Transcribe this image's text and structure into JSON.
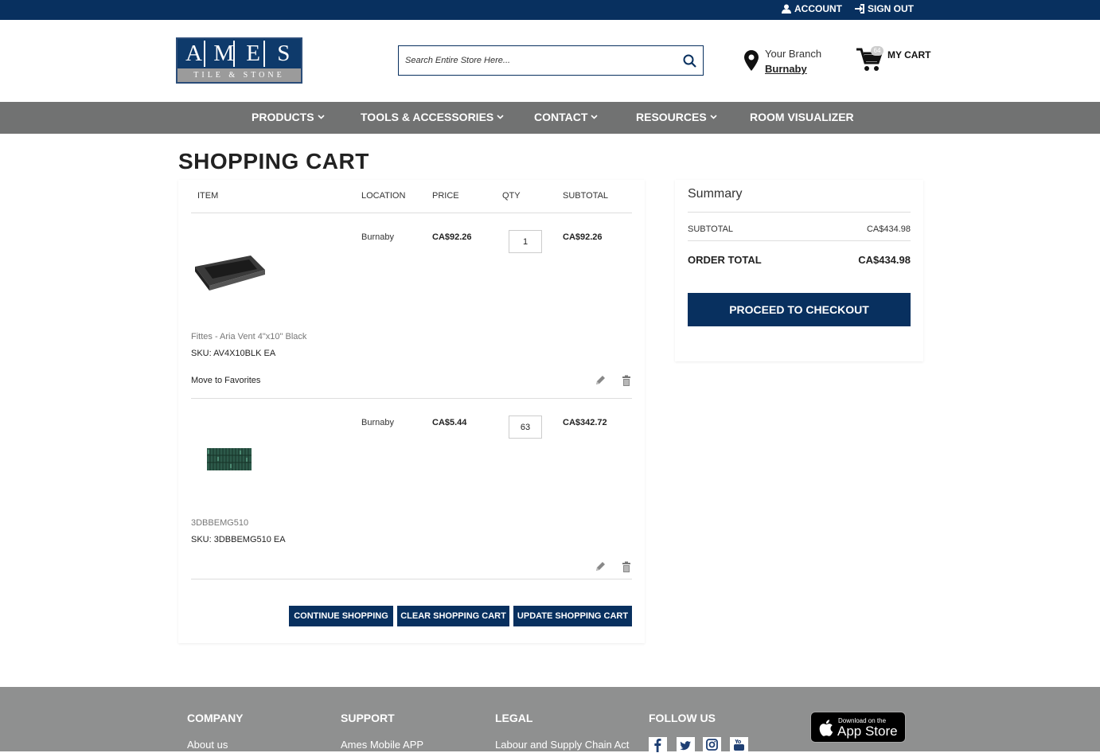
{
  "topbar": {
    "account": "ACCOUNT",
    "signout": "SIGN OUT"
  },
  "logo": {
    "letters": [
      "A",
      "M",
      "E",
      "S"
    ],
    "sub": "TILE & STONE"
  },
  "search": {
    "placeholder": "Search Entire Store Here..."
  },
  "branch": {
    "label": "Your Branch",
    "name": "Burnaby"
  },
  "cart": {
    "label": "MY CART",
    "count": "64"
  },
  "nav": {
    "products": "PRODUCTS",
    "tools": "TOOLS & ACCESSORIES",
    "contact": "CONTACT",
    "resources": "RESOURCES",
    "room": "ROOM VISUALIZER"
  },
  "page_title": "SHOPPING CART",
  "table": {
    "item": "ITEM",
    "location": "LOCATION",
    "price": "PRICE",
    "qty": "QTY",
    "subtotal": "SUBTOTAL"
  },
  "items": [
    {
      "location": "Burnaby",
      "price": "CA$92.26",
      "qty": "1",
      "subtotal": "CA$92.26",
      "name": "Fittes - Aria Vent 4\"x10\" Black",
      "sku": "SKU: AV4X10BLK EA",
      "favorites": "Move to Favorites"
    },
    {
      "location": "Burnaby",
      "price": "CA$5.44",
      "qty": "63",
      "subtotal": "CA$342.72",
      "name": "3DBBEMG510",
      "sku": "SKU: 3DBBEMG510 EA"
    }
  ],
  "buttons": {
    "continue": "CONTINUE SHOPPING",
    "clear": "CLEAR SHOPPING CART",
    "update": "UPDATE SHOPPING CART"
  },
  "summary": {
    "title": "Summary",
    "subtotal_label": "SUBTOTAL",
    "subtotal_value": "CA$434.98",
    "total_label": "ORDER TOTAL",
    "total_value": "CA$434.98",
    "checkout": "PROCEED TO CHECKOUT"
  },
  "footer": {
    "company": "COMPANY",
    "support": "SUPPORT",
    "legal": "LEGAL",
    "follow": "FOLLOW US",
    "about": "About us",
    "mobile": "Ames Mobile APP",
    "labour": "Labour and Supply Chain Act",
    "appstore_small": "Download on the",
    "appstore_big": "App Store"
  },
  "colors": {
    "brand_navy": "#08305f",
    "nav_gray": "#717272",
    "footer_gray": "#8f9090"
  }
}
